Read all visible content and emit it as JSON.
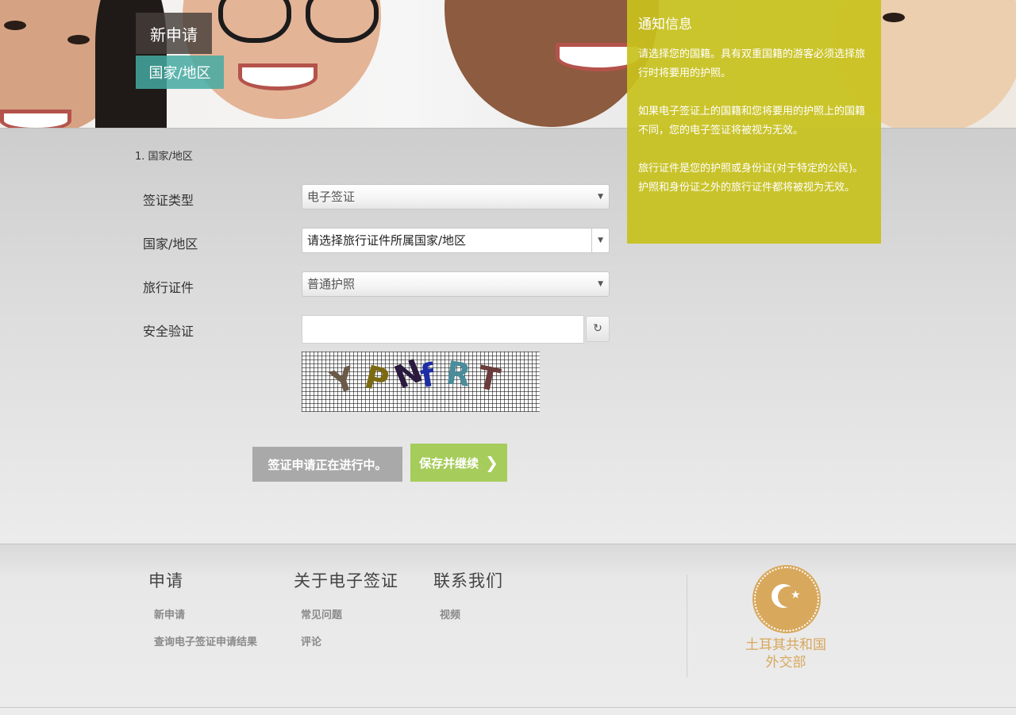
{
  "hero": {
    "title": "新申请",
    "subtitle": "国家/地区"
  },
  "form": {
    "step": "1. 国家/地区",
    "visa_type": {
      "label": "签证类型",
      "value": "电子签证"
    },
    "country": {
      "label": "国家/地区",
      "placeholder": "请选择旅行证件所属国家/地区"
    },
    "travel_document": {
      "label": "旅行证件",
      "value": "普通护照"
    },
    "security": {
      "label": "安全验证"
    },
    "captcha_text": [
      "Y",
      "P",
      "N",
      "f",
      "R",
      "T"
    ],
    "in_progress_label": "签证申请正在进行中。",
    "save_label": "保存并继续"
  },
  "notice": {
    "title": "通知信息",
    "p1": "请选择您的国籍。具有双重国籍的游客必须选择旅行时将要用的护照。",
    "p2": "如果电子签证上的国籍和您将要用的护照上的国籍不同，您的电子签证将被视为无效。",
    "p3": "旅行证件是您的护照或身份证(对于特定的公民)。护照和身份证之外的旅行证件都将被视为无效。"
  },
  "footer": {
    "apply": {
      "title": "申请",
      "links": [
        "新申请",
        "查询电子签证申请结果"
      ]
    },
    "about": {
      "title": "关于电子签证",
      "links": [
        "常见问题",
        "评论"
      ]
    },
    "contact": {
      "title": "联系我们",
      "links": [
        "视频"
      ]
    },
    "ministry_line1": "土耳其共和国",
    "ministry_line2": "外交部"
  },
  "colors": {
    "notice_bg": "#c8c21e",
    "save_button": "#a6cc5b",
    "progress_button": "#a9a9a9",
    "hero_title_bg": "#463e3a",
    "hero_subtitle_bg": "#44aaa2",
    "seal": "#d8a85c"
  },
  "icons": {
    "dropdown": "triangle-down",
    "refresh": "refresh-icon",
    "save_chevron": "chevron-right-icon"
  }
}
